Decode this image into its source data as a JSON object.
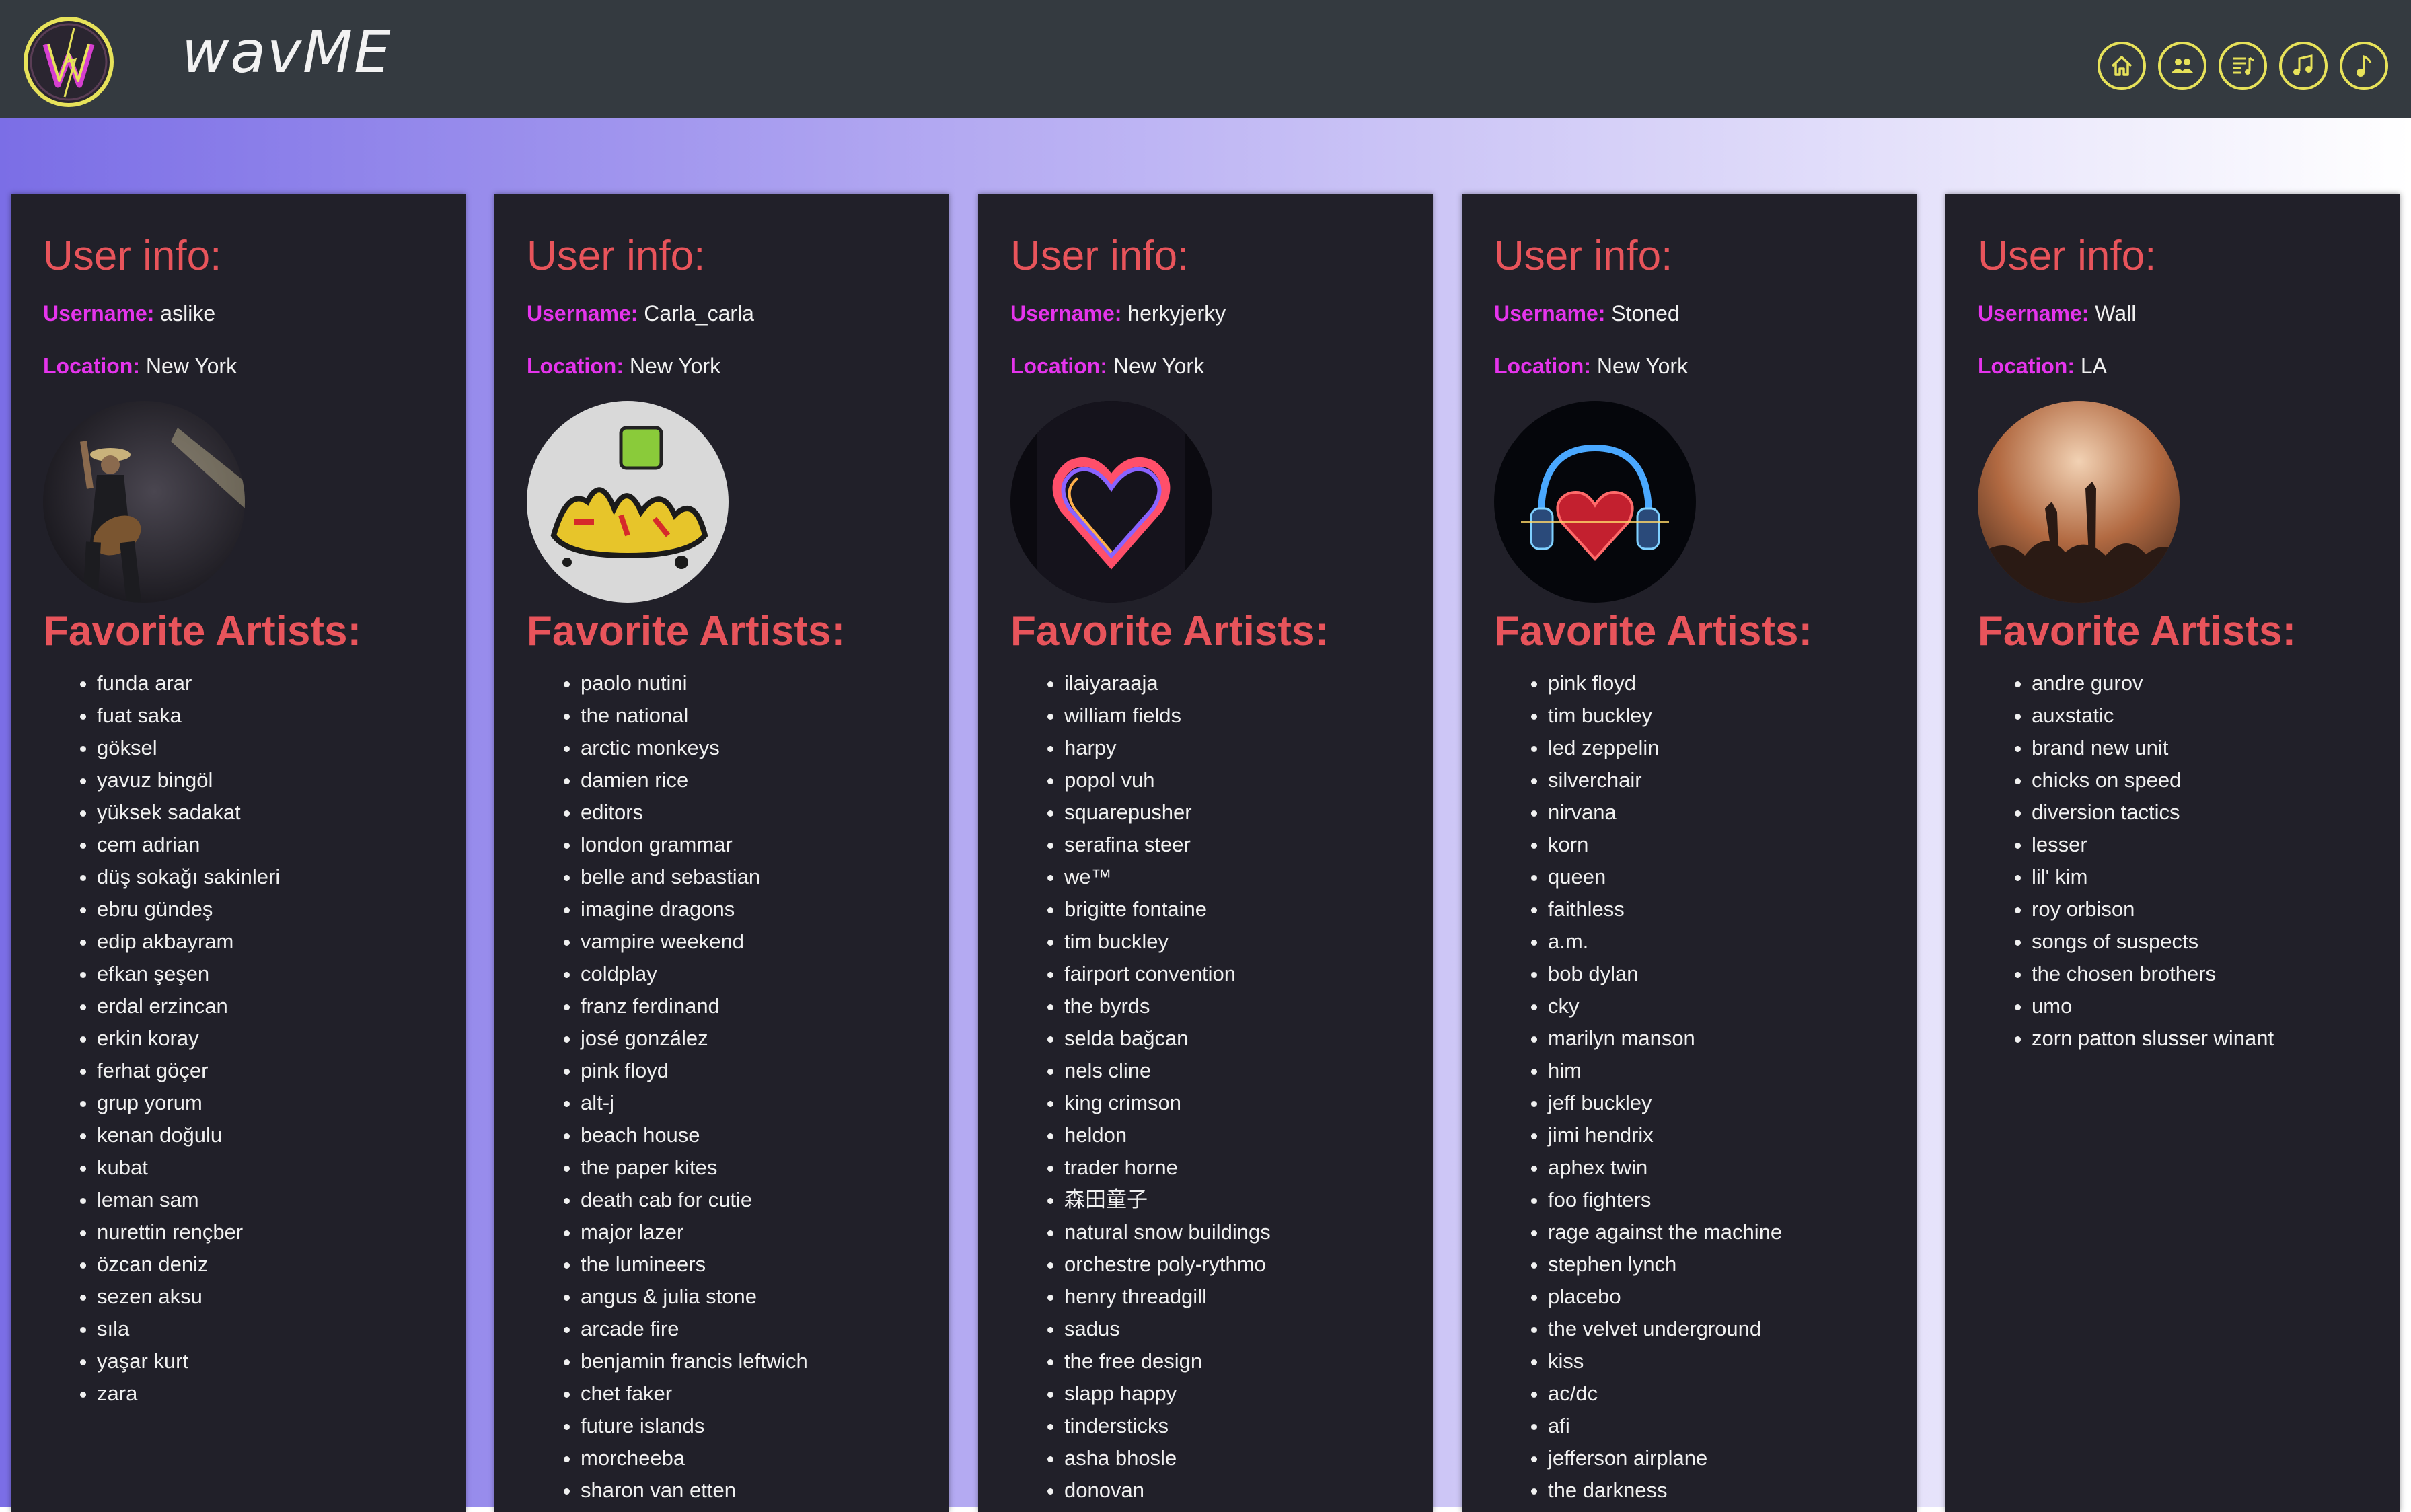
{
  "app": {
    "brand": "wavME",
    "logo_letter": "W"
  },
  "nav": [
    "home-icon",
    "users-icon",
    "playlist-icon",
    "music-notes-icon",
    "music-note-icon"
  ],
  "colors": {
    "navbar": "#343a40",
    "accent_icons": "#e7e25a",
    "card_bg": "#212029",
    "heading": "#e8545b",
    "key_label": "#e534ec",
    "text": "#f0f0f0"
  },
  "labels": {
    "user_info": "User info:",
    "username": "Username:",
    "location": "Location:",
    "favorite_artists": "Favorite Artists:"
  },
  "users": [
    {
      "username": "aslike",
      "location": "New York",
      "artists": [
        "funda arar",
        "fuat saka",
        "göksel",
        "yavuz bingöl",
        "yüksek sadakat",
        "cem adrian",
        "düş sokağı sakinleri",
        "ebru gündeş",
        "edip akbayram",
        "efkan şeşen",
        "erdal erzincan",
        "erkin koray",
        "ferhat göçer",
        "grup yorum",
        "kenan doğulu",
        "kubat",
        "leman sam",
        "nurettin rençber",
        "özcan deniz",
        "sezen aksu",
        "sıla",
        "yaşar kurt",
        "zara"
      ]
    },
    {
      "username": "Carla_carla",
      "location": "New York",
      "artists": [
        "paolo nutini",
        "the national",
        "arctic monkeys",
        "damien rice",
        "editors",
        "london grammar",
        "belle and sebastian",
        "imagine dragons",
        "vampire weekend",
        "coldplay",
        "franz ferdinand",
        "josé gonzález",
        "pink floyd",
        "alt-j",
        "beach house",
        "the paper kites",
        "death cab for cutie",
        "major lazer",
        "the lumineers",
        "angus & julia stone",
        "arcade fire",
        "benjamin francis leftwich",
        "chet faker",
        "future islands",
        "morcheeba",
        "sharon van etten"
      ]
    },
    {
      "username": "herkyjerky",
      "location": "New York",
      "artists": [
        "ilaiyaraaja",
        "william fields",
        "harpy",
        "popol vuh",
        "squarepusher",
        "serafina steer",
        "we™",
        "brigitte fontaine",
        "tim buckley",
        "fairport convention",
        "the byrds",
        "selda bağcan",
        "nels cline",
        "king crimson",
        "heldon",
        "trader horne",
        "森田童子",
        "natural snow buildings",
        "orchestre poly-rythmo",
        "henry threadgill",
        "sadus",
        "the free design",
        "slapp happy",
        "tindersticks",
        "asha bhosle",
        "donovan"
      ]
    },
    {
      "username": "Stoned",
      "location": "New York",
      "artists": [
        "pink floyd",
        "tim buckley",
        "led zeppelin",
        "silverchair",
        "nirvana",
        "korn",
        "queen",
        "faithless",
        "a.m.",
        "bob dylan",
        "cky",
        "marilyn manson",
        "him",
        "jeff buckley",
        "jimi hendrix",
        "aphex twin",
        "foo fighters",
        "rage against the machine",
        "stephen lynch",
        "placebo",
        "the velvet underground",
        "kiss",
        "ac/dc",
        "afi",
        "jefferson airplane",
        "the darkness"
      ]
    },
    {
      "username": "Wall",
      "location": "LA",
      "artists": [
        "andre gurov",
        "auxstatic",
        "brand new unit",
        "chicks on speed",
        "diversion tactics",
        "lesser",
        "lil' kim",
        "roy orbison",
        "songs of suspects",
        "the chosen brothers",
        "umo",
        "zorn patton slusser winant"
      ]
    }
  ]
}
